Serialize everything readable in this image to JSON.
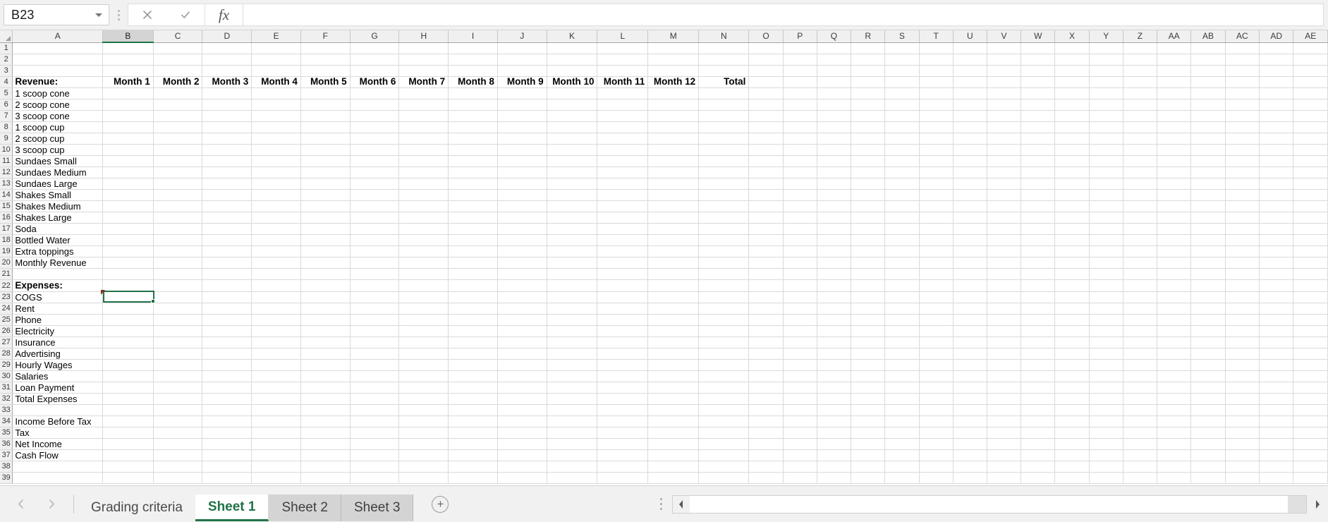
{
  "formula_bar": {
    "name_box_value": "B23",
    "name_box_icon": "chevron-down-icon",
    "cancel_icon": "close-icon",
    "accept_icon": "check-icon",
    "function_icon": "fx-icon",
    "formula_value": "",
    "formula_placeholder": ""
  },
  "grid": {
    "columns": [
      "A",
      "B",
      "C",
      "D",
      "E",
      "F",
      "G",
      "H",
      "I",
      "J",
      "K",
      "L",
      "M",
      "N",
      "O",
      "P",
      "Q",
      "R",
      "S",
      "T",
      "U",
      "V",
      "W",
      "X",
      "Y",
      "Z",
      "AA",
      "AB",
      "AC",
      "AD",
      "AE"
    ],
    "selected_column": "B",
    "selected_cell": "B23",
    "rows": [
      {
        "n": 1,
        "a": "",
        "cells": []
      },
      {
        "n": 2,
        "a": "",
        "cells": []
      },
      {
        "n": 3,
        "a": "",
        "cells": []
      },
      {
        "n": 4,
        "a": "Revenue:",
        "bold": true,
        "cells": [
          "Month 1",
          "Month 2",
          "Month 3",
          "Month 4",
          "Month 5",
          "Month 6",
          "Month 7",
          "Month 8",
          "Month 9",
          "Month 10",
          "Month 11",
          "Month 12",
          "Total"
        ]
      },
      {
        "n": 5,
        "a": "1 scoop cone",
        "cells": []
      },
      {
        "n": 6,
        "a": "2 scoop cone",
        "cells": []
      },
      {
        "n": 7,
        "a": "3 scoop cone",
        "cells": []
      },
      {
        "n": 8,
        "a": "1 scoop cup",
        "cells": []
      },
      {
        "n": 9,
        "a": "2 scoop cup",
        "cells": []
      },
      {
        "n": 10,
        "a": "3 scoop cup",
        "cells": []
      },
      {
        "n": 11,
        "a": "Sundaes Small",
        "cells": []
      },
      {
        "n": 12,
        "a": "Sundaes Medium",
        "cells": []
      },
      {
        "n": 13,
        "a": "Sundaes Large",
        "cells": []
      },
      {
        "n": 14,
        "a": "Shakes Small",
        "cells": []
      },
      {
        "n": 15,
        "a": "Shakes Medium",
        "cells": []
      },
      {
        "n": 16,
        "a": "Shakes Large",
        "cells": []
      },
      {
        "n": 17,
        "a": "Soda",
        "cells": []
      },
      {
        "n": 18,
        "a": "Bottled Water",
        "cells": []
      },
      {
        "n": 19,
        "a": "Extra toppings",
        "cells": []
      },
      {
        "n": 20,
        "a": "Monthly Revenue",
        "cells": []
      },
      {
        "n": 21,
        "a": "",
        "cells": []
      },
      {
        "n": 22,
        "a": "Expenses:",
        "bold": true,
        "cells": []
      },
      {
        "n": 23,
        "a": "COGS",
        "cells": []
      },
      {
        "n": 24,
        "a": "Rent",
        "cells": []
      },
      {
        "n": 25,
        "a": "Phone",
        "cells": []
      },
      {
        "n": 26,
        "a": "Electricity",
        "cells": []
      },
      {
        "n": 27,
        "a": "Insurance",
        "cells": []
      },
      {
        "n": 28,
        "a": "Advertising",
        "cells": []
      },
      {
        "n": 29,
        "a": "Hourly Wages",
        "cells": []
      },
      {
        "n": 30,
        "a": "Salaries",
        "cells": []
      },
      {
        "n": 31,
        "a": "Loan Payment",
        "cells": []
      },
      {
        "n": 32,
        "a": "Total Expenses",
        "cells": []
      },
      {
        "n": 33,
        "a": "",
        "cells": []
      },
      {
        "n": 34,
        "a": "Income Before Tax",
        "cells": []
      },
      {
        "n": 35,
        "a": "Tax",
        "cells": []
      },
      {
        "n": 36,
        "a": "Net Income",
        "cells": []
      },
      {
        "n": 37,
        "a": "Cash Flow",
        "cells": []
      },
      {
        "n": 38,
        "a": "",
        "cells": []
      },
      {
        "n": 39,
        "a": "",
        "cells": []
      }
    ]
  },
  "bottom": {
    "prev_sheet_icon": "triangle-left-icon",
    "next_sheet_icon": "triangle-right-icon",
    "tabs": [
      {
        "label": "Grading criteria",
        "state": "plain"
      },
      {
        "label": "Sheet 1",
        "state": "active"
      },
      {
        "label": "Sheet 2",
        "state": "inactive"
      },
      {
        "label": "Sheet 3",
        "state": "inactive"
      }
    ],
    "add_sheet_label": "+",
    "scroll_left_icon": "triangle-left-icon",
    "scroll_right_icon": "triangle-right-icon"
  },
  "colors": {
    "accent_green": "#217346",
    "header_grey": "#f0f0f0",
    "selected_header": "#d4d4d4",
    "gridline": "#dadada",
    "cursor_red": "#8b2b22"
  }
}
